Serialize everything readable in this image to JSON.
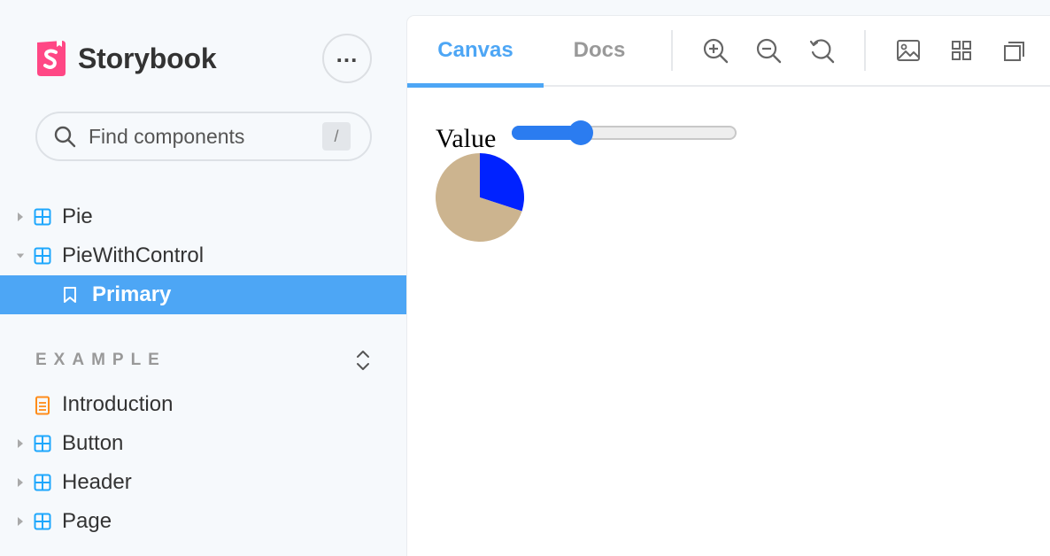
{
  "app": {
    "name": "Storybook",
    "more_label": "..."
  },
  "search": {
    "placeholder": "Find components",
    "shortcut": "/"
  },
  "tree": [
    {
      "label": "Pie",
      "kind": "component",
      "expanded": false
    },
    {
      "label": "PieWithControl",
      "kind": "component",
      "expanded": true
    },
    {
      "label": "Primary",
      "kind": "story",
      "selected": true
    }
  ],
  "section": {
    "label": "EXAMPLE"
  },
  "example_items": [
    {
      "label": "Introduction",
      "kind": "document"
    },
    {
      "label": "Button",
      "kind": "component"
    },
    {
      "label": "Header",
      "kind": "component"
    },
    {
      "label": "Page",
      "kind": "component"
    }
  ],
  "toolbar": {
    "tabs": [
      {
        "label": "Canvas",
        "active": true
      },
      {
        "label": "Docs",
        "active": false
      }
    ],
    "tools": [
      "zoom-in-icon",
      "zoom-out-icon",
      "reset-zoom-icon",
      "background-icon",
      "grid-icon",
      "viewport-icon"
    ]
  },
  "preview": {
    "control_label": "Value",
    "slider_value": 0.3,
    "pie": {
      "values": [
        0.3,
        0.7
      ],
      "colors": [
        "#0022ff",
        "#ccb48f"
      ]
    }
  },
  "colors": {
    "accent": "#4da6f5",
    "sidebar_bg": "#f6f9fc",
    "logo": "#ff4785",
    "component_icon": "#1ea7fd",
    "document_icon": "#ff8c1a"
  }
}
